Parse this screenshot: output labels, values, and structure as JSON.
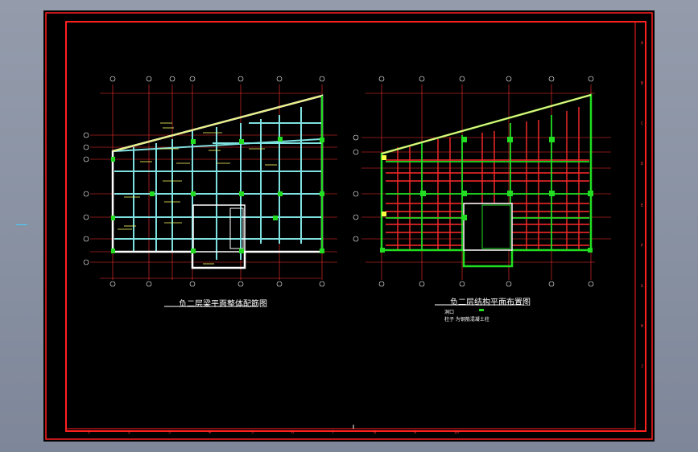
{
  "titles": {
    "left": "负二层梁平面整体配筋图",
    "right": "负二层结构平面布置图"
  },
  "legend_notes": [
    "洞口",
    "柱子 为钢筋混凝土柱"
  ],
  "border_columns": [
    "1",
    "2",
    "3",
    "4",
    "5",
    "6",
    "7",
    "8",
    "9",
    "10"
  ],
  "border_rows": [
    "A",
    "B",
    "C",
    "D",
    "E",
    "F",
    "G",
    "H",
    "J"
  ],
  "colors": {
    "paper": "#000000",
    "border": "#ff2020",
    "outline": "#ffffff",
    "axis": "#ff3030",
    "beam": "#7fe0e0",
    "column": "#22dd22",
    "annotation": "#ffff66",
    "app_bg": "#8a93a4"
  }
}
